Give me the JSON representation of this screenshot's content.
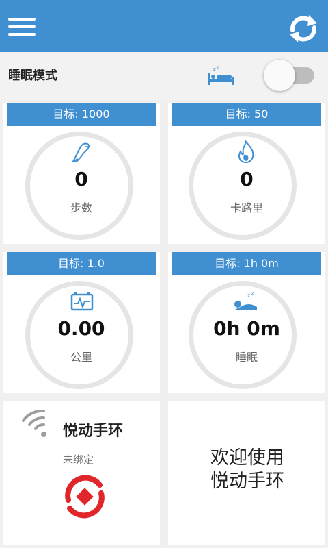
{
  "header": {
    "menu_icon": "hamburger-menu-icon",
    "sync_icon": "sync-icon"
  },
  "sleep_mode": {
    "label": "睡眠模式",
    "icon": "sleep-bed-icon",
    "enabled": false
  },
  "cards": [
    {
      "target": "目标: 1000",
      "value": "0",
      "label": "步数",
      "icon": "footprint-icon"
    },
    {
      "target": "目标: 50",
      "value": "0",
      "label": "卡路里",
      "icon": "flame-icon"
    },
    {
      "target": "目标: 1.0",
      "value": "0.00",
      "label": "公里",
      "icon": "distance-monitor-icon"
    },
    {
      "target": "目标: 1h 0m",
      "value": "0h 0m",
      "label": "睡眠",
      "icon": "sleeping-person-icon"
    }
  ],
  "device": {
    "title": "悦动手环",
    "status": "未绑定",
    "signal_icon": "signal-icon",
    "logo": "brand-logo"
  },
  "welcome": {
    "line1": "欢迎使用",
    "line2": "悦动手环"
  },
  "colors": {
    "primary": "#3f8fd1",
    "ring": "#e5e5e5",
    "logo_red": "#e0262a"
  }
}
